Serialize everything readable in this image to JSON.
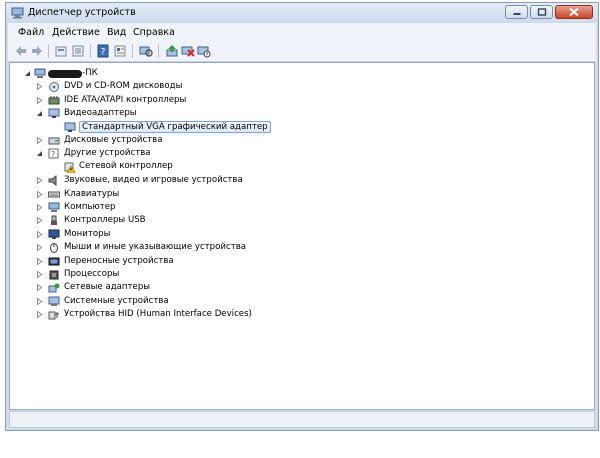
{
  "window": {
    "title": "Диспетчер устройств"
  },
  "menu": [
    "Файл",
    "Действие",
    "Вид",
    "Справка"
  ],
  "tree": {
    "root": {
      "label": "-ПК",
      "expanded": true
    },
    "items": [
      {
        "label": "DVD и CD-ROM дисководы",
        "icon": "dvd-drive-icon",
        "expanded": false
      },
      {
        "label": "IDE ATA/ATAPI контроллеры",
        "icon": "ide-controller-icon",
        "expanded": false
      },
      {
        "label": "Видеоадаптеры",
        "icon": "display-adapter-icon",
        "expanded": true,
        "children": [
          {
            "label": "Стандартный VGA графический адаптер",
            "icon": "vga-adapter-icon",
            "selected": true
          }
        ]
      },
      {
        "label": "Дисковые устройства",
        "icon": "disk-drive-icon",
        "expanded": false
      },
      {
        "label": "Другие устройства",
        "icon": "unknown-device-icon",
        "expanded": true,
        "children": [
          {
            "label": "Сетевой контроллер",
            "icon": "warning-device-icon",
            "selected": false
          }
        ]
      },
      {
        "label": "Звуковые, видео и игровые устройства",
        "icon": "speaker-icon",
        "expanded": false
      },
      {
        "label": "Клавиатуры",
        "icon": "keyboard-icon",
        "expanded": false
      },
      {
        "label": "Компьютер",
        "icon": "computer-icon",
        "expanded": false
      },
      {
        "label": "Контроллеры USB",
        "icon": "usb-icon",
        "expanded": false
      },
      {
        "label": "Мониторы",
        "icon": "monitor-icon",
        "expanded": false
      },
      {
        "label": "Мыши и иные указывающие устройства",
        "icon": "mouse-icon",
        "expanded": false
      },
      {
        "label": "Переносные устройства",
        "icon": "portable-device-icon",
        "expanded": false
      },
      {
        "label": "Процессоры",
        "icon": "processor-icon",
        "expanded": false
      },
      {
        "label": "Сетевые адаптеры",
        "icon": "network-adapter-icon",
        "expanded": false
      },
      {
        "label": "Системные устройства",
        "icon": "system-device-icon",
        "expanded": false
      },
      {
        "label": "Устройства HID (Human Interface Devices)",
        "icon": "hid-icon",
        "expanded": false
      }
    ]
  },
  "colors": {
    "selection_border": "#7da2ce",
    "selection_fill": "#dde9f8",
    "close_button": "#c9462a"
  }
}
